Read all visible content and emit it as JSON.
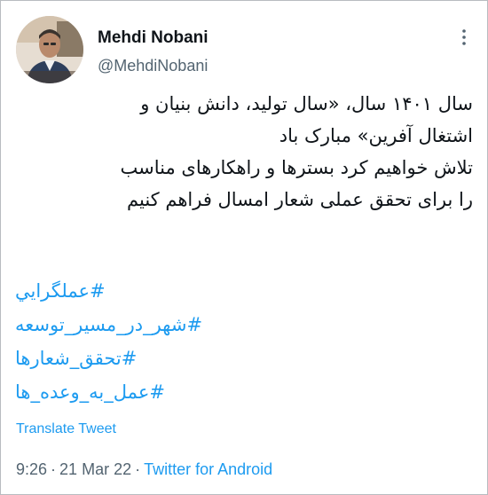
{
  "tweet": {
    "author": {
      "name": "Mehdi Nobani",
      "handle": "@MehdiNobani"
    },
    "text_lines": [
      "سال ۱۴۰۱ سال، «سال تولید، دانش بنیان و",
      "اشتغال آفرین» مبارک باد",
      "تلاش خواهیم کرد بسترها و راهکارهای مناسب",
      "را برای تحقق عملی شعار امسال فراهم کنیم"
    ],
    "hashtags": [
      "#عملگرايي",
      "#شهر_در_مسیر_توسعه",
      "#تحقق_شعارها",
      "#عمل_به_وعده_ها"
    ],
    "translate_label": "Translate Tweet",
    "time": "9:26 PM",
    "time_display": "9:26",
    "separator": "·",
    "date": "21 Mar 22",
    "source": "Twitter for Android"
  },
  "colors": {
    "link": "#1d9bf0",
    "text": "#0f1419",
    "muted": "#536471"
  },
  "icons": {
    "more": "more-dots-icon"
  }
}
